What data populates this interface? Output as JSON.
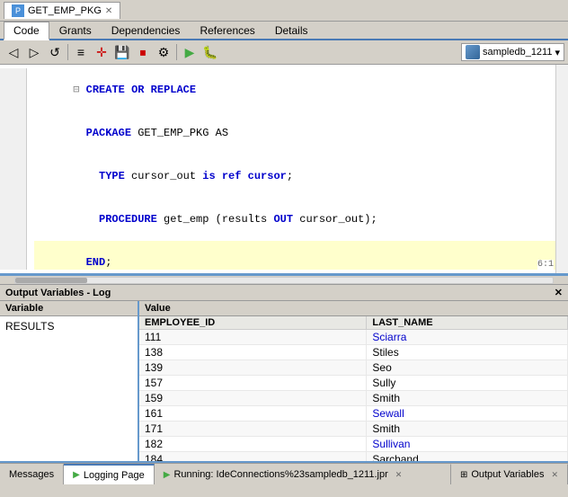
{
  "window": {
    "title": "GET_EMP_PKG",
    "tabs": [
      {
        "label": "GET_EMP_PKG",
        "active": true
      }
    ]
  },
  "menu_tabs": [
    {
      "label": "Code",
      "active": true
    },
    {
      "label": "Grants",
      "active": false
    },
    {
      "label": "Dependencies",
      "active": false
    },
    {
      "label": "References",
      "active": false
    },
    {
      "label": "Details",
      "active": false
    }
  ],
  "toolbar": {
    "db_selector": "sampledb_1211"
  },
  "code": {
    "lines": [
      {
        "num": "",
        "text": "CREATE OR REPLACE",
        "type": "keyword"
      },
      {
        "num": "",
        "text": "  PACKAGE GET_EMP_PKG AS",
        "type": "package"
      },
      {
        "num": "",
        "text": "    TYPE cursor_out is ref cursor;",
        "type": "normal"
      },
      {
        "num": "",
        "text": "    PROCEDURE get_emp (results OUT cursor_out);",
        "type": "normal"
      },
      {
        "num": "",
        "text": "  END;",
        "type": "normal"
      },
      {
        "num": "",
        "text": "",
        "type": "empty"
      }
    ],
    "line_col": "6:1"
  },
  "output_variables": {
    "header": "Output Variables - Log",
    "variables_label": "Variable",
    "results_var": "RESULTS",
    "value_label": "Value",
    "columns": [
      "EMPLOYEE_ID",
      "LAST_NAME"
    ],
    "rows": [
      {
        "id": "111",
        "name": "Sciarra"
      },
      {
        "id": "138",
        "name": "Stiles"
      },
      {
        "id": "139",
        "name": "Seo"
      },
      {
        "id": "157",
        "name": "Sully"
      },
      {
        "id": "159",
        "name": "Smith"
      },
      {
        "id": "161",
        "name": "Sewall"
      },
      {
        "id": "171",
        "name": "Smith"
      },
      {
        "id": "182",
        "name": "Sullivan"
      },
      {
        "id": "184",
        "name": "Sarchand"
      }
    ]
  },
  "status_bar": {
    "messages_label": "Messages",
    "logging_label": "Logging Page",
    "running_label": "Running: IdeConnections%23sampledb_1211.jpr",
    "output_variables_label": "Output Variables"
  }
}
